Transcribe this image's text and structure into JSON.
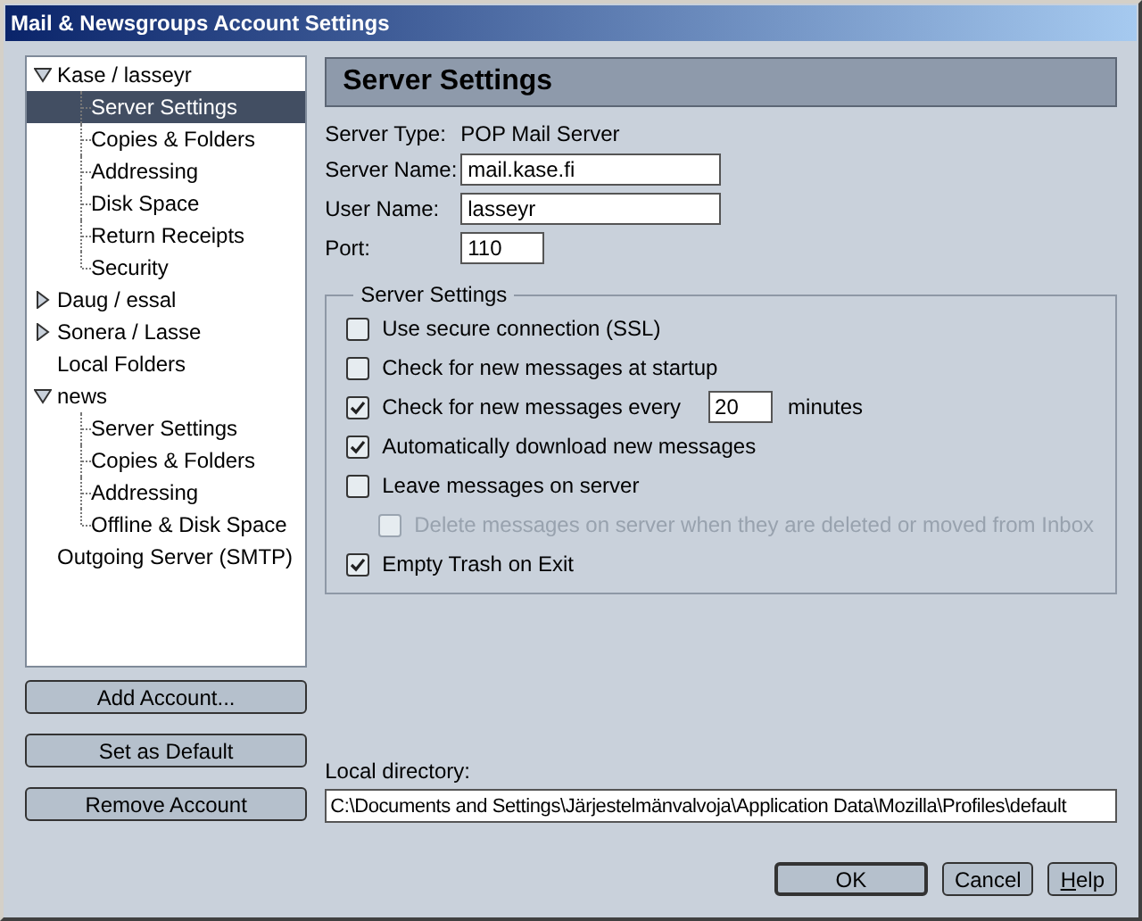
{
  "window": {
    "title": "Mail & Newsgroups Account Settings"
  },
  "tree": [
    {
      "label": "Kase / lasseyr",
      "expanded": true,
      "children": [
        {
          "label": "Server Settings",
          "selected": true
        },
        {
          "label": "Copies & Folders",
          "selected": false
        },
        {
          "label": "Addressing",
          "selected": false
        },
        {
          "label": "Disk Space",
          "selected": false
        },
        {
          "label": "Return Receipts",
          "selected": false
        },
        {
          "label": "Security",
          "selected": false
        }
      ]
    },
    {
      "label": "Daug / essal",
      "expanded": false
    },
    {
      "label": "Sonera / Lasse",
      "expanded": false
    },
    {
      "label": "Local Folders"
    },
    {
      "label": "news",
      "expanded": true,
      "children": [
        {
          "label": "Server Settings",
          "selected": false
        },
        {
          "label": "Copies & Folders",
          "selected": false
        },
        {
          "label": "Addressing",
          "selected": false
        },
        {
          "label": "Offline & Disk Space",
          "selected": false
        }
      ]
    },
    {
      "label": "Outgoing Server (SMTP)"
    }
  ],
  "account_buttons": [
    "Add Account...",
    "Set as Default",
    "Remove Account"
  ],
  "panel": {
    "title": "Server Settings",
    "fields": [
      {
        "kind": "text",
        "label": "Server Type:",
        "value": "POP Mail Server"
      },
      {
        "kind": "input",
        "label": "Server Name:",
        "value": "mail.kase.fi"
      },
      {
        "kind": "input",
        "label": "User Name:",
        "value": "lasseyr"
      },
      {
        "kind": "short",
        "label": "Port:",
        "value": "110"
      }
    ],
    "group": {
      "title": "Server Settings",
      "options": [
        {
          "kind": "option",
          "label": "Use secure connection (SSL)",
          "checked": false,
          "disabled": false
        },
        {
          "kind": "option",
          "label": "Check for new messages at startup",
          "checked": false,
          "disabled": false
        },
        {
          "kind": "interval",
          "label": "Check for new messages every",
          "checked": true,
          "disabled": false,
          "value": "20",
          "unit": "minutes"
        },
        {
          "kind": "option",
          "label": "Automatically download new messages",
          "checked": true,
          "disabled": false
        },
        {
          "kind": "option",
          "label": "Leave messages on server",
          "checked": false,
          "disabled": false
        },
        {
          "kind": "suboption",
          "label": "Delete messages on server when they are deleted or moved from Inbox",
          "checked": false,
          "disabled": true
        },
        {
          "kind": "option",
          "label": "Empty Trash on Exit",
          "checked": true,
          "disabled": false
        }
      ]
    },
    "local_directory": {
      "label": "Local directory:",
      "value": "C:\\Documents and Settings\\Järjestelmänvalvoja\\Application Data\\Mozilla\\Profiles\\default"
    }
  },
  "dialog_buttons": [
    {
      "label": "OK",
      "default": true,
      "mnemonic": false
    },
    {
      "label": "Cancel",
      "default": false,
      "mnemonic": false
    },
    {
      "label": "Help",
      "default": false,
      "mnemonic": true
    }
  ]
}
